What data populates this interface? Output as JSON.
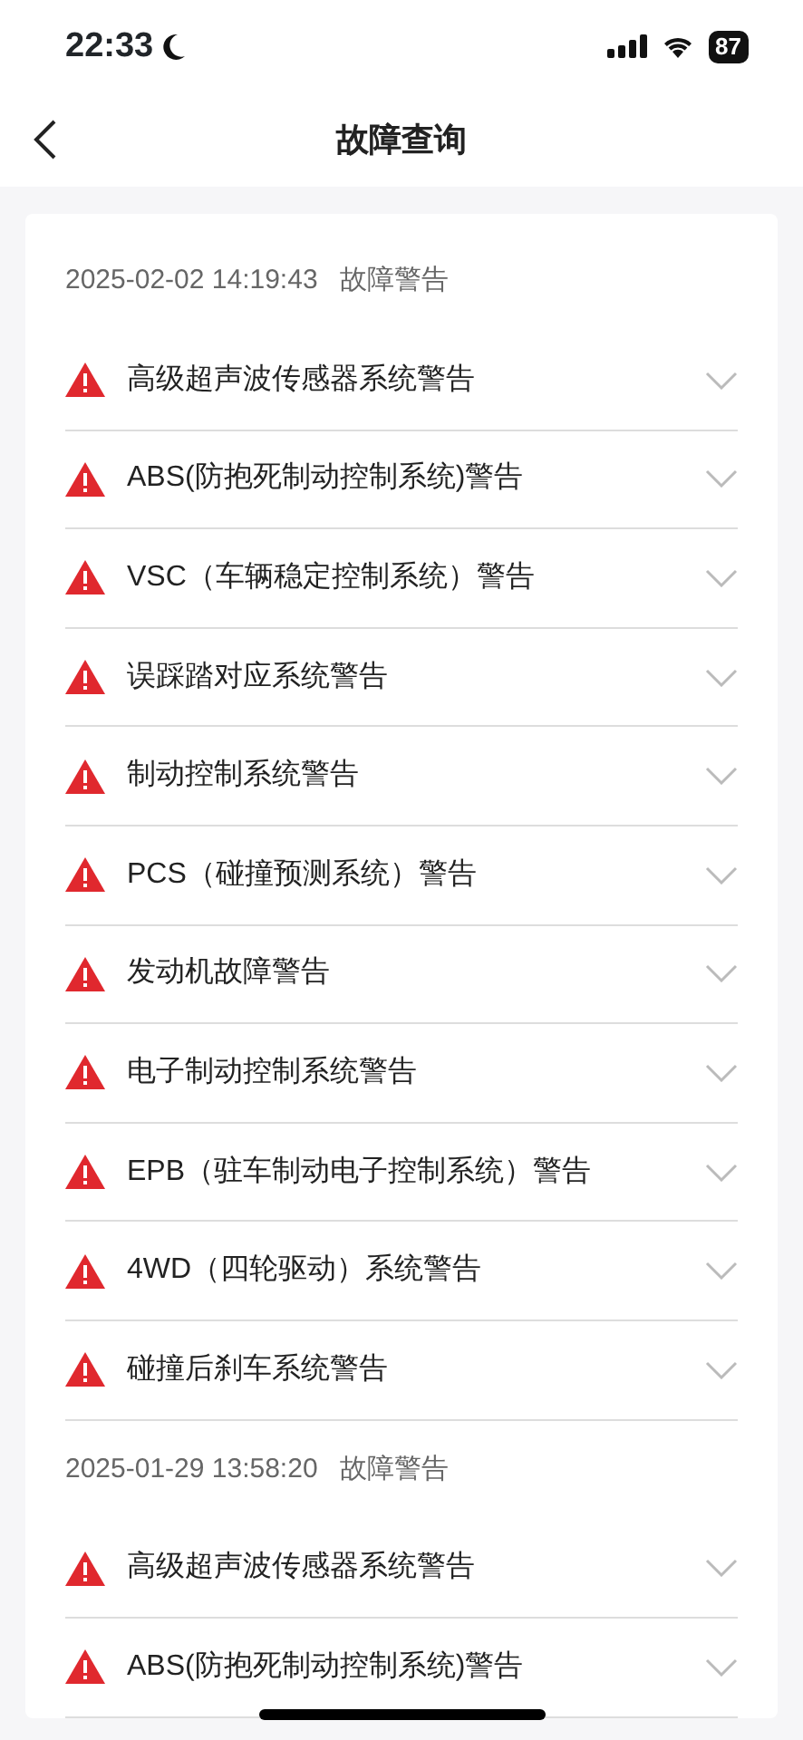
{
  "status_bar": {
    "time": "22:33",
    "battery": "87"
  },
  "nav": {
    "title": "故障查询"
  },
  "groups": [
    {
      "timestamp": "2025-02-02 14:19:43",
      "type": "故障警告",
      "items": [
        {
          "label": "高级超声波传感器系统警告",
          "expanded": false
        },
        {
          "label": "ABS(防抱死制动控制系统)警告",
          "expanded": false
        },
        {
          "label": "VSC（车辆稳定控制系统）警告",
          "expanded": false
        },
        {
          "label": "误踩踏对应系统警告",
          "expanded": false
        },
        {
          "label": "制动控制系统警告",
          "expanded": false
        },
        {
          "label": "PCS（碰撞预测系统）警告",
          "expanded": false
        },
        {
          "label": "发动机故障警告",
          "expanded": false
        },
        {
          "label": "电子制动控制系统警告",
          "expanded": false
        },
        {
          "label": "EPB（驻车制动电子控制系统）警告",
          "expanded": false
        },
        {
          "label": "4WD（四轮驱动）系统警告",
          "expanded": false
        },
        {
          "label": "碰撞后刹车系统警告",
          "expanded": false
        }
      ]
    },
    {
      "timestamp": "2025-01-29 13:58:20",
      "type": "故障警告",
      "items": [
        {
          "label": "高级超声波传感器系统警告",
          "expanded": false
        },
        {
          "label": "ABS(防抱死制动控制系统)警告",
          "expanded": false
        }
      ]
    }
  ]
}
